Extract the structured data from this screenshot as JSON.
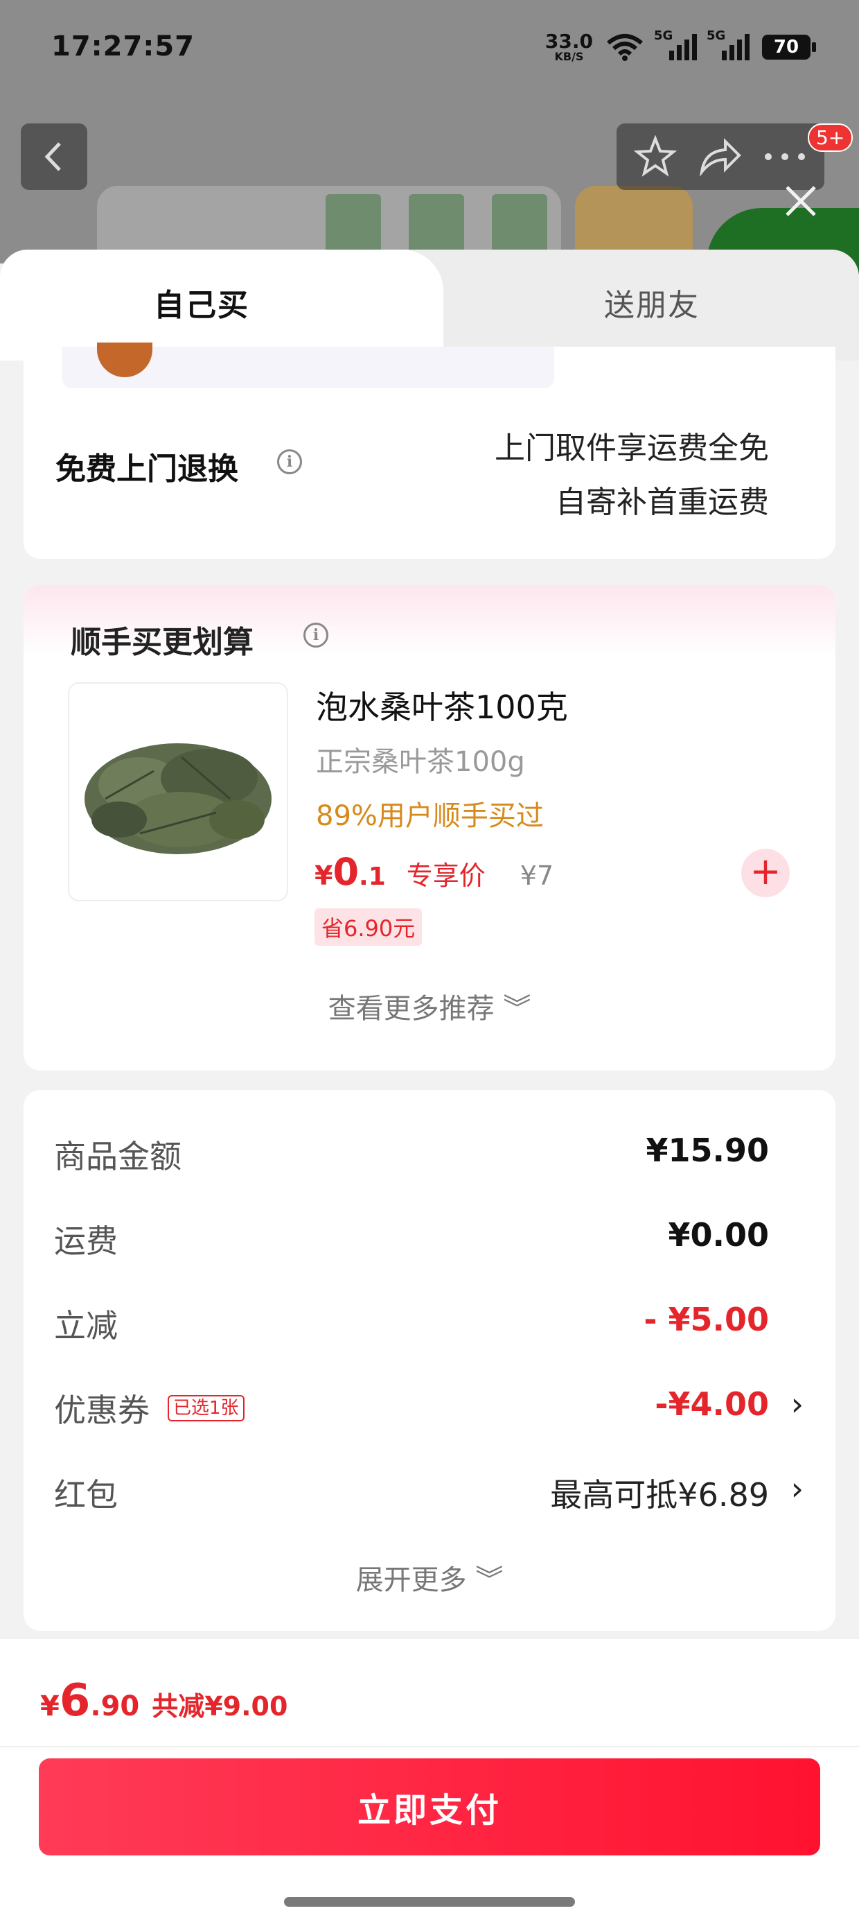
{
  "status_bar": {
    "time": "17:27:57",
    "net_speed": "33.0",
    "net_unit": "KB/S",
    "signal1": "5G",
    "signal2": "5G",
    "battery": "70"
  },
  "header": {
    "badge": "5+"
  },
  "tabs": {
    "self": "自己买",
    "gift": "送朋友"
  },
  "returns": {
    "title": "免费上门退换",
    "line1": "上门取件享运费全免",
    "line2": "自寄补首重运费"
  },
  "recommendation": {
    "title": "顺手买更划算",
    "product_name": "泡水桑叶茶100克",
    "product_sub": "正宗桑叶茶100g",
    "bought_text": "89%用户顺手买过",
    "price_currency": "¥",
    "price_int": "0",
    "price_dec": ".1",
    "price_label": "专享价",
    "original_price": "¥7",
    "save_text": "省6.90元",
    "more": "查看更多推荐 ︾"
  },
  "price_details": {
    "rows": [
      {
        "label": "商品金额",
        "value": "¥15.90"
      },
      {
        "label": "运费",
        "value": "¥0.00"
      },
      {
        "label": "立减",
        "value": "- ¥5.00"
      },
      {
        "label": "优惠券",
        "badge": "已选1张",
        "value": "-¥4.00"
      },
      {
        "label": "红包",
        "value": "最高可抵¥6.89"
      }
    ],
    "more": "展开更多 ︾"
  },
  "footer": {
    "currency": "¥",
    "total_int": "6",
    "total_dec": ".90",
    "reduce_text": "共减¥9.00",
    "pay_button": "立即支付"
  }
}
